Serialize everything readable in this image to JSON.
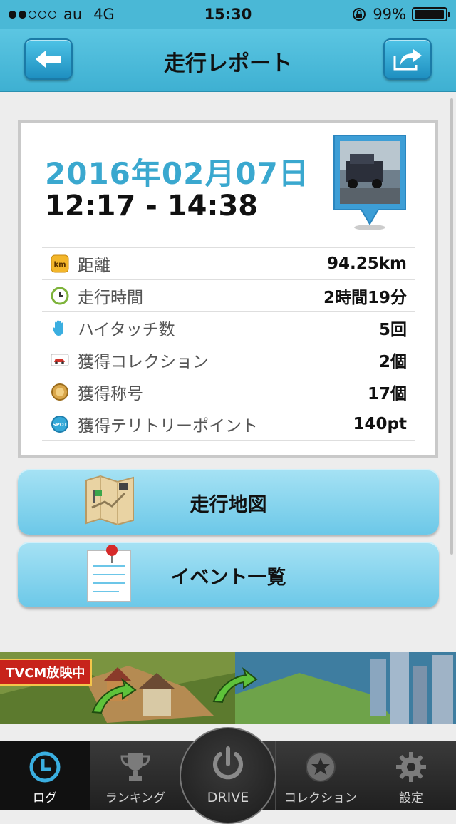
{
  "status_bar": {
    "carrier": "au",
    "network": "4G",
    "time": "15:30",
    "battery": "99%",
    "signal_bars_filled": 2,
    "signal_bars_total": 5
  },
  "nav": {
    "title": "走行レポート"
  },
  "report": {
    "date": "2016年02月07日",
    "time_range": "12:17 - 14:38",
    "rows": [
      {
        "icon": "km-icon",
        "label": "距離",
        "value": "94.25km"
      },
      {
        "icon": "clock-icon",
        "label": "走行時間",
        "value": "2時間19分"
      },
      {
        "icon": "hand-icon",
        "label": "ハイタッチ数",
        "value": "5回"
      },
      {
        "icon": "car-card-icon",
        "label": "獲得コレクション",
        "value": "2個"
      },
      {
        "icon": "medal-icon",
        "label": "獲得称号",
        "value": "17個"
      },
      {
        "icon": "spot-icon",
        "label": "獲得テリトリーポイント",
        "value": "140pt"
      }
    ]
  },
  "buttons": {
    "map": "走行地図",
    "events": "イベント一覧"
  },
  "banner": {
    "tag": "TVCM放映中"
  },
  "tabbar": {
    "log": "ログ",
    "ranking": "ランキング",
    "drive": "DRIVE",
    "collection": "コレクション",
    "settings": "設定",
    "selected": "log"
  },
  "colors": {
    "accent": "#4ab8d6",
    "date": "#3aa8cf",
    "button": "#8fd6ef"
  }
}
